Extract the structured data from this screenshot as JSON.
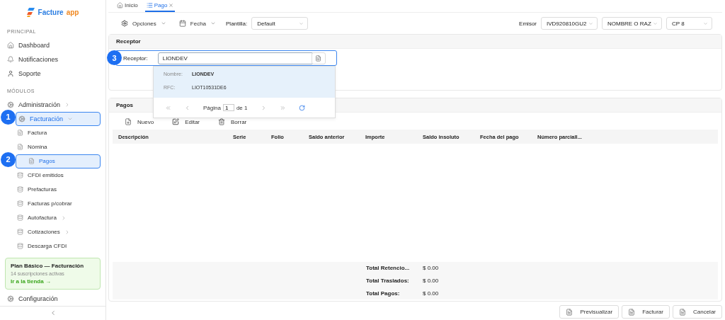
{
  "logo": {
    "name": "Facture",
    "suffix": "app"
  },
  "sidebar": {
    "sections": [
      {
        "title": "PRINCIPAL",
        "items": [
          {
            "label": "Dashboard",
            "selected": false
          },
          {
            "label": "Notificaciones",
            "selected": false
          },
          {
            "label": "Soporte",
            "selected": false
          }
        ]
      },
      {
        "title": "MÓDULOS",
        "items": [
          {
            "label": "Administración",
            "selected": false,
            "expanded": false
          },
          {
            "label": "Facturación",
            "selected": true,
            "expanded": true,
            "callout": "1",
            "children": [
              {
                "label": "Factura",
                "selected": false
              },
              {
                "label": "Nómina",
                "selected": false
              },
              {
                "label": "Pagos",
                "selected": true,
                "callout": "2"
              },
              {
                "label": "CFDI emitidos",
                "selected": false
              },
              {
                "label": "Prefacturas",
                "selected": false
              },
              {
                "label": "Facturas p/cobrar",
                "selected": false
              },
              {
                "label": "Autofactura",
                "selected": false,
                "expanded": false
              },
              {
                "label": "Cotizaciones",
                "selected": false,
                "expanded": false
              },
              {
                "label": "Descarga CFDI",
                "selected": false
              }
            ]
          }
        ]
      }
    ],
    "plan": {
      "title": "Plan Básico — Facturación",
      "subtitle": "14 suscripciones activas",
      "link": "Ir a la tienda →"
    },
    "footer_item": {
      "label": "Configuración"
    }
  },
  "tabs": [
    {
      "label": "Inicio",
      "selected": false,
      "closable": false
    },
    {
      "label": "Pago",
      "selected": true,
      "closable": true
    }
  ],
  "toolbar": {
    "menus": [
      "Opciones",
      "Fecha"
    ],
    "template_label": "Plantilla:",
    "template_value": "Default",
    "issuer_label": "Emisor",
    "issuer_selects": [
      "IVD920810GU2",
      "NOMBRE O RAZ",
      "CP 8"
    ]
  },
  "receptor_panel": {
    "title": "Receptor",
    "label": "Receptor:",
    "value": "LIONDEV",
    "callout": "3",
    "suggestion": {
      "fields": [
        {
          "label": "Nombre:",
          "value": "LIONDEV"
        },
        {
          "label": "RFC:",
          "value": "LIOT10531DE6"
        }
      ],
      "page_label": "Página",
      "page": "1",
      "of_label": "de 1"
    }
  },
  "payments_panel": {
    "title": "Pagos",
    "actions": [
      "Nuevo",
      "Editar",
      "Borrar"
    ],
    "columns": [
      "Descripción",
      "Serie",
      "Folio",
      "Saldo anterior",
      "Importe",
      "Saldo insoluto",
      "Fecha del pago",
      "Número parciall..."
    ],
    "totals": [
      {
        "label": "Total Retencio...",
        "value": "$ 0.00"
      },
      {
        "label": "Total Traslados:",
        "value": "$ 0.00"
      },
      {
        "label": "Total Pagos:",
        "value": "$ 0.00"
      }
    ]
  },
  "footer_buttons": [
    "Previsualizar",
    "Facturar",
    "Cancelar"
  ]
}
